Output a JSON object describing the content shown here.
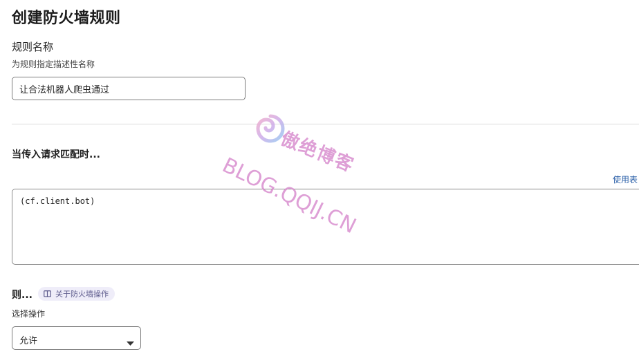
{
  "page": {
    "title": "创建防火墙规则"
  },
  "rule_name": {
    "label": "规则名称",
    "help": "为规则指定描述性名称",
    "value": "让合法机器人爬虫通过"
  },
  "match_section": {
    "heading": "当传入请求匹配时...",
    "builder_link": "使用表",
    "expression": "(cf.client.bot)"
  },
  "action_section": {
    "heading": "则...",
    "docs_badge": "关于防火墙操作",
    "select_label": "选择操作",
    "selected_action": "允许"
  },
  "watermark": {
    "brand_cn": "傲绝博客",
    "brand_url": "BLOG.QQIJ.CN"
  },
  "colors": {
    "link": "#2a5fa8",
    "badge_bg": "#efedf9",
    "watermark": "#d98fcf"
  }
}
